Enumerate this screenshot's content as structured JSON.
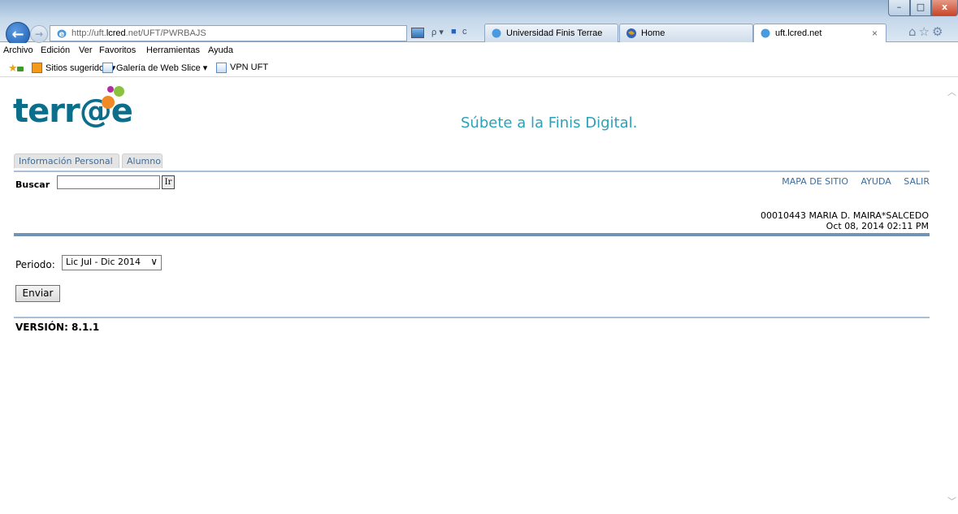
{
  "browser": {
    "address_url_prefix": "http://uft.",
    "address_url_domain": "lcred",
    "address_url_suffix": ".net/UFT/PWRBAJS",
    "search_glyph": "ρ ▾",
    "compat_glyph": "■",
    "refresh_glyph": "c",
    "tabs": [
      {
        "label": "Universidad Finis Terrae"
      },
      {
        "label": "Home"
      },
      {
        "label": "uft.lcred.net"
      }
    ],
    "tab_close": "×",
    "toolbar_icons": "⌂☆⚙",
    "window_controls": {
      "minimize": "–",
      "maximize": "□",
      "close": "x"
    }
  },
  "menu": {
    "items": [
      "Archivo",
      "Edición",
      "Ver",
      "Favoritos",
      "Herramientas",
      "Ayuda"
    ]
  },
  "favorites": {
    "items": [
      "Sitios sugeridos ▾",
      "Galería de Web Slice ▾",
      "VPN UFT"
    ]
  },
  "page": {
    "logo_text": "terr@e",
    "slogan": "Súbete a la Finis Digital.",
    "tabs": [
      "Información Personal",
      "Alumno"
    ],
    "search_label": "Buscar",
    "search_value": "",
    "go_button": "Ir",
    "top_links": [
      "MAPA DE SITIO",
      "AYUDA",
      "SALIR"
    ],
    "user_line": "00010443 MARIA D. MAIRA*SALCEDO",
    "datetime": "Oct 08, 2014 02:11 PM",
    "periodo_label": "Periodo:",
    "periodo_value": "Lic Jul - Dic 2014",
    "submit_button": "Enviar",
    "version": "VERSIÓN: 8.1.1"
  },
  "colors": {
    "link": "#3f6c97",
    "logo": "#0b6f8c",
    "slogan": "#2aa2b9",
    "rule": "#6f94b8"
  }
}
